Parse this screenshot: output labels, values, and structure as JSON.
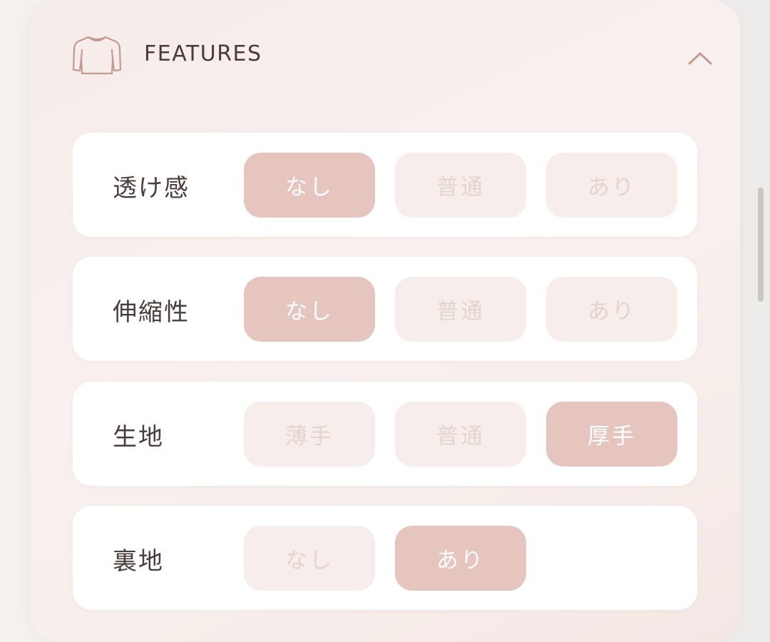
{
  "header": {
    "icon": "sweater-icon",
    "title": "FEATURES",
    "collapse_icon": "chevron-up-icon"
  },
  "colors": {
    "selected_bg": "#e5c5be",
    "unselected_bg": "#f7eeeb",
    "unselected_text": "#e3d4d0",
    "label_text": "#4a3d3b",
    "icon_stroke": "#c49a8e"
  },
  "features": [
    {
      "label": "透け感",
      "options": [
        "なし",
        "普通",
        "あり"
      ],
      "selected": 0
    },
    {
      "label": "伸縮性",
      "options": [
        "なし",
        "普通",
        "あり"
      ],
      "selected": 0
    },
    {
      "label": "生地",
      "options": [
        "薄手",
        "普通",
        "厚手"
      ],
      "selected": 2
    },
    {
      "label": "裏地",
      "options": [
        "なし",
        "あり"
      ],
      "selected": 1
    }
  ]
}
